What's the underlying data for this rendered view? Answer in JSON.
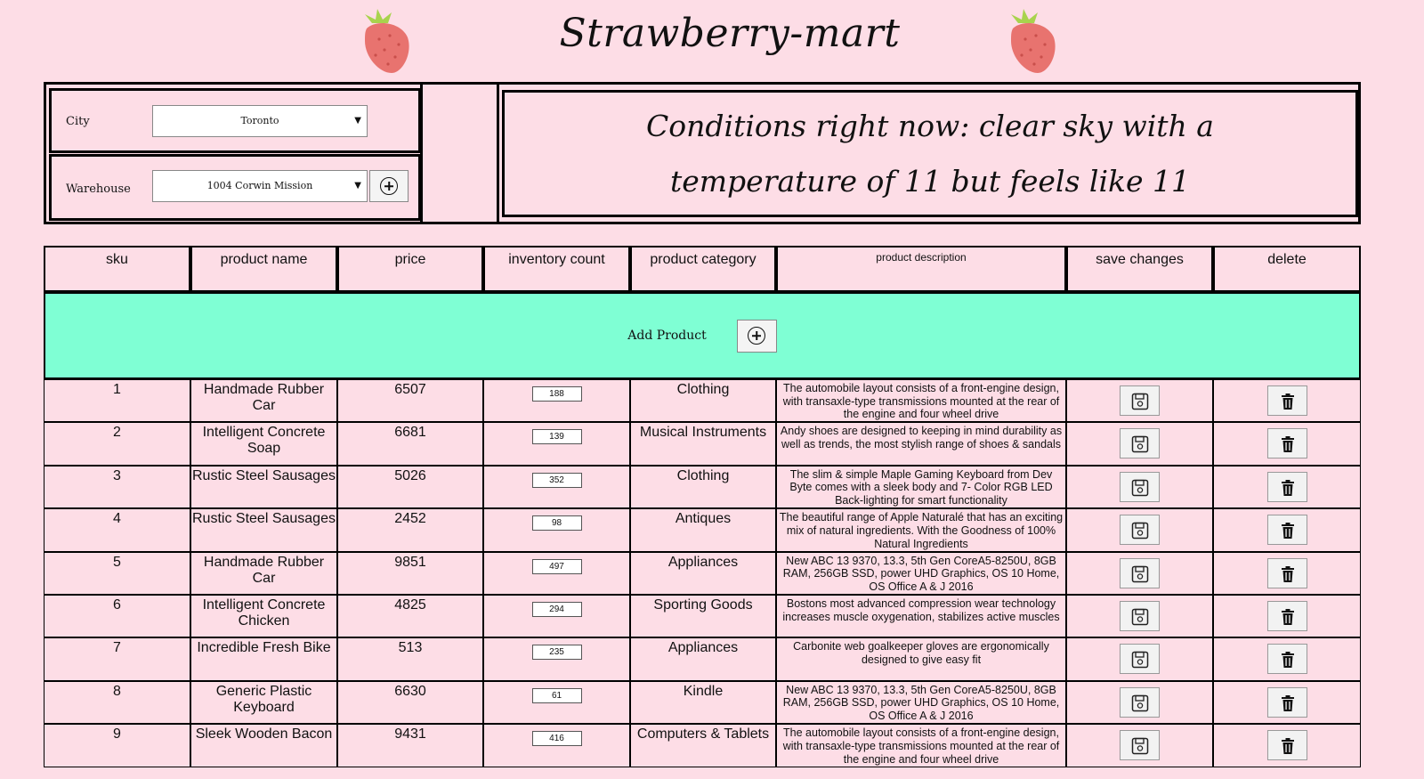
{
  "header": {
    "title": "Strawberry-mart"
  },
  "controls": {
    "city_label": "City",
    "city_value": "Toronto",
    "warehouse_label": "Warehouse",
    "warehouse_value": "1004 Corwin Mission"
  },
  "weather": {
    "text": "Conditions right now: clear sky with a temperature of 11 but feels like 11"
  },
  "table": {
    "headers": [
      "sku",
      "product name",
      "price",
      "inventory count",
      "product category",
      "product description",
      "save changes",
      "delete"
    ],
    "add_product_label": "Add Product",
    "rows": [
      {
        "sku": "1",
        "name": "Handmade Rubber Car",
        "price": "6507",
        "inventory": "188",
        "category": "Clothing",
        "description": "The automobile layout consists of a front-engine design, with transaxle-type transmissions mounted at the rear of the engine and four wheel drive"
      },
      {
        "sku": "2",
        "name": "Intelligent Concrete Soap",
        "price": "6681",
        "inventory": "139",
        "category": "Musical Instruments",
        "description": "Andy shoes are designed to keeping in mind durability as well as trends, the most stylish range of shoes & sandals"
      },
      {
        "sku": "3",
        "name": "Rustic Steel Sausages",
        "price": "5026",
        "inventory": "352",
        "category": "Clothing",
        "description": "The slim & simple Maple Gaming Keyboard from Dev Byte comes with a sleek body and 7- Color RGB LED Back-lighting for smart functionality"
      },
      {
        "sku": "4",
        "name": "Rustic Steel Sausages",
        "price": "2452",
        "inventory": "98",
        "category": "Antiques",
        "description": "The beautiful range of Apple Naturalé that has an exciting mix of natural ingredients. With the Goodness of 100% Natural Ingredients"
      },
      {
        "sku": "5",
        "name": "Handmade Rubber Car",
        "price": "9851",
        "inventory": "497",
        "category": "Appliances",
        "description": "New ABC 13 9370, 13.3, 5th Gen CoreA5-8250U, 8GB RAM, 256GB SSD, power UHD Graphics, OS 10 Home, OS Office A & J 2016"
      },
      {
        "sku": "6",
        "name": "Intelligent Concrete Chicken",
        "price": "4825",
        "inventory": "294",
        "category": "Sporting Goods",
        "description": "Bostons most advanced compression wear technology increases muscle oxygenation, stabilizes active muscles"
      },
      {
        "sku": "7",
        "name": "Incredible Fresh Bike",
        "price": "513",
        "inventory": "235",
        "category": "Appliances",
        "description": "Carbonite web goalkeeper gloves are ergonomically designed to give easy fit"
      },
      {
        "sku": "8",
        "name": "Generic Plastic Keyboard",
        "price": "6630",
        "inventory": "61",
        "category": "Kindle",
        "description": "New ABC 13 9370, 13.3, 5th Gen CoreA5-8250U, 8GB RAM, 256GB SSD, power UHD Graphics, OS 10 Home, OS Office A & J 2016"
      },
      {
        "sku": "9",
        "name": "Sleek Wooden Bacon",
        "price": "9431",
        "inventory": "416",
        "category": "Computers & Tablets",
        "description": "The automobile layout consists of a front-engine design, with transaxle-type transmissions mounted at the rear of the engine and four wheel drive"
      }
    ]
  },
  "icons": {
    "logo": "strawberry-icon",
    "add": "plus-circle-icon",
    "save": "floppy-disk-icon",
    "delete": "trash-icon"
  },
  "colors": {
    "background": "#fddde6",
    "add_row": "#7fffd4",
    "strawberry": "#e8736f",
    "leaf": "#a8d34d"
  }
}
